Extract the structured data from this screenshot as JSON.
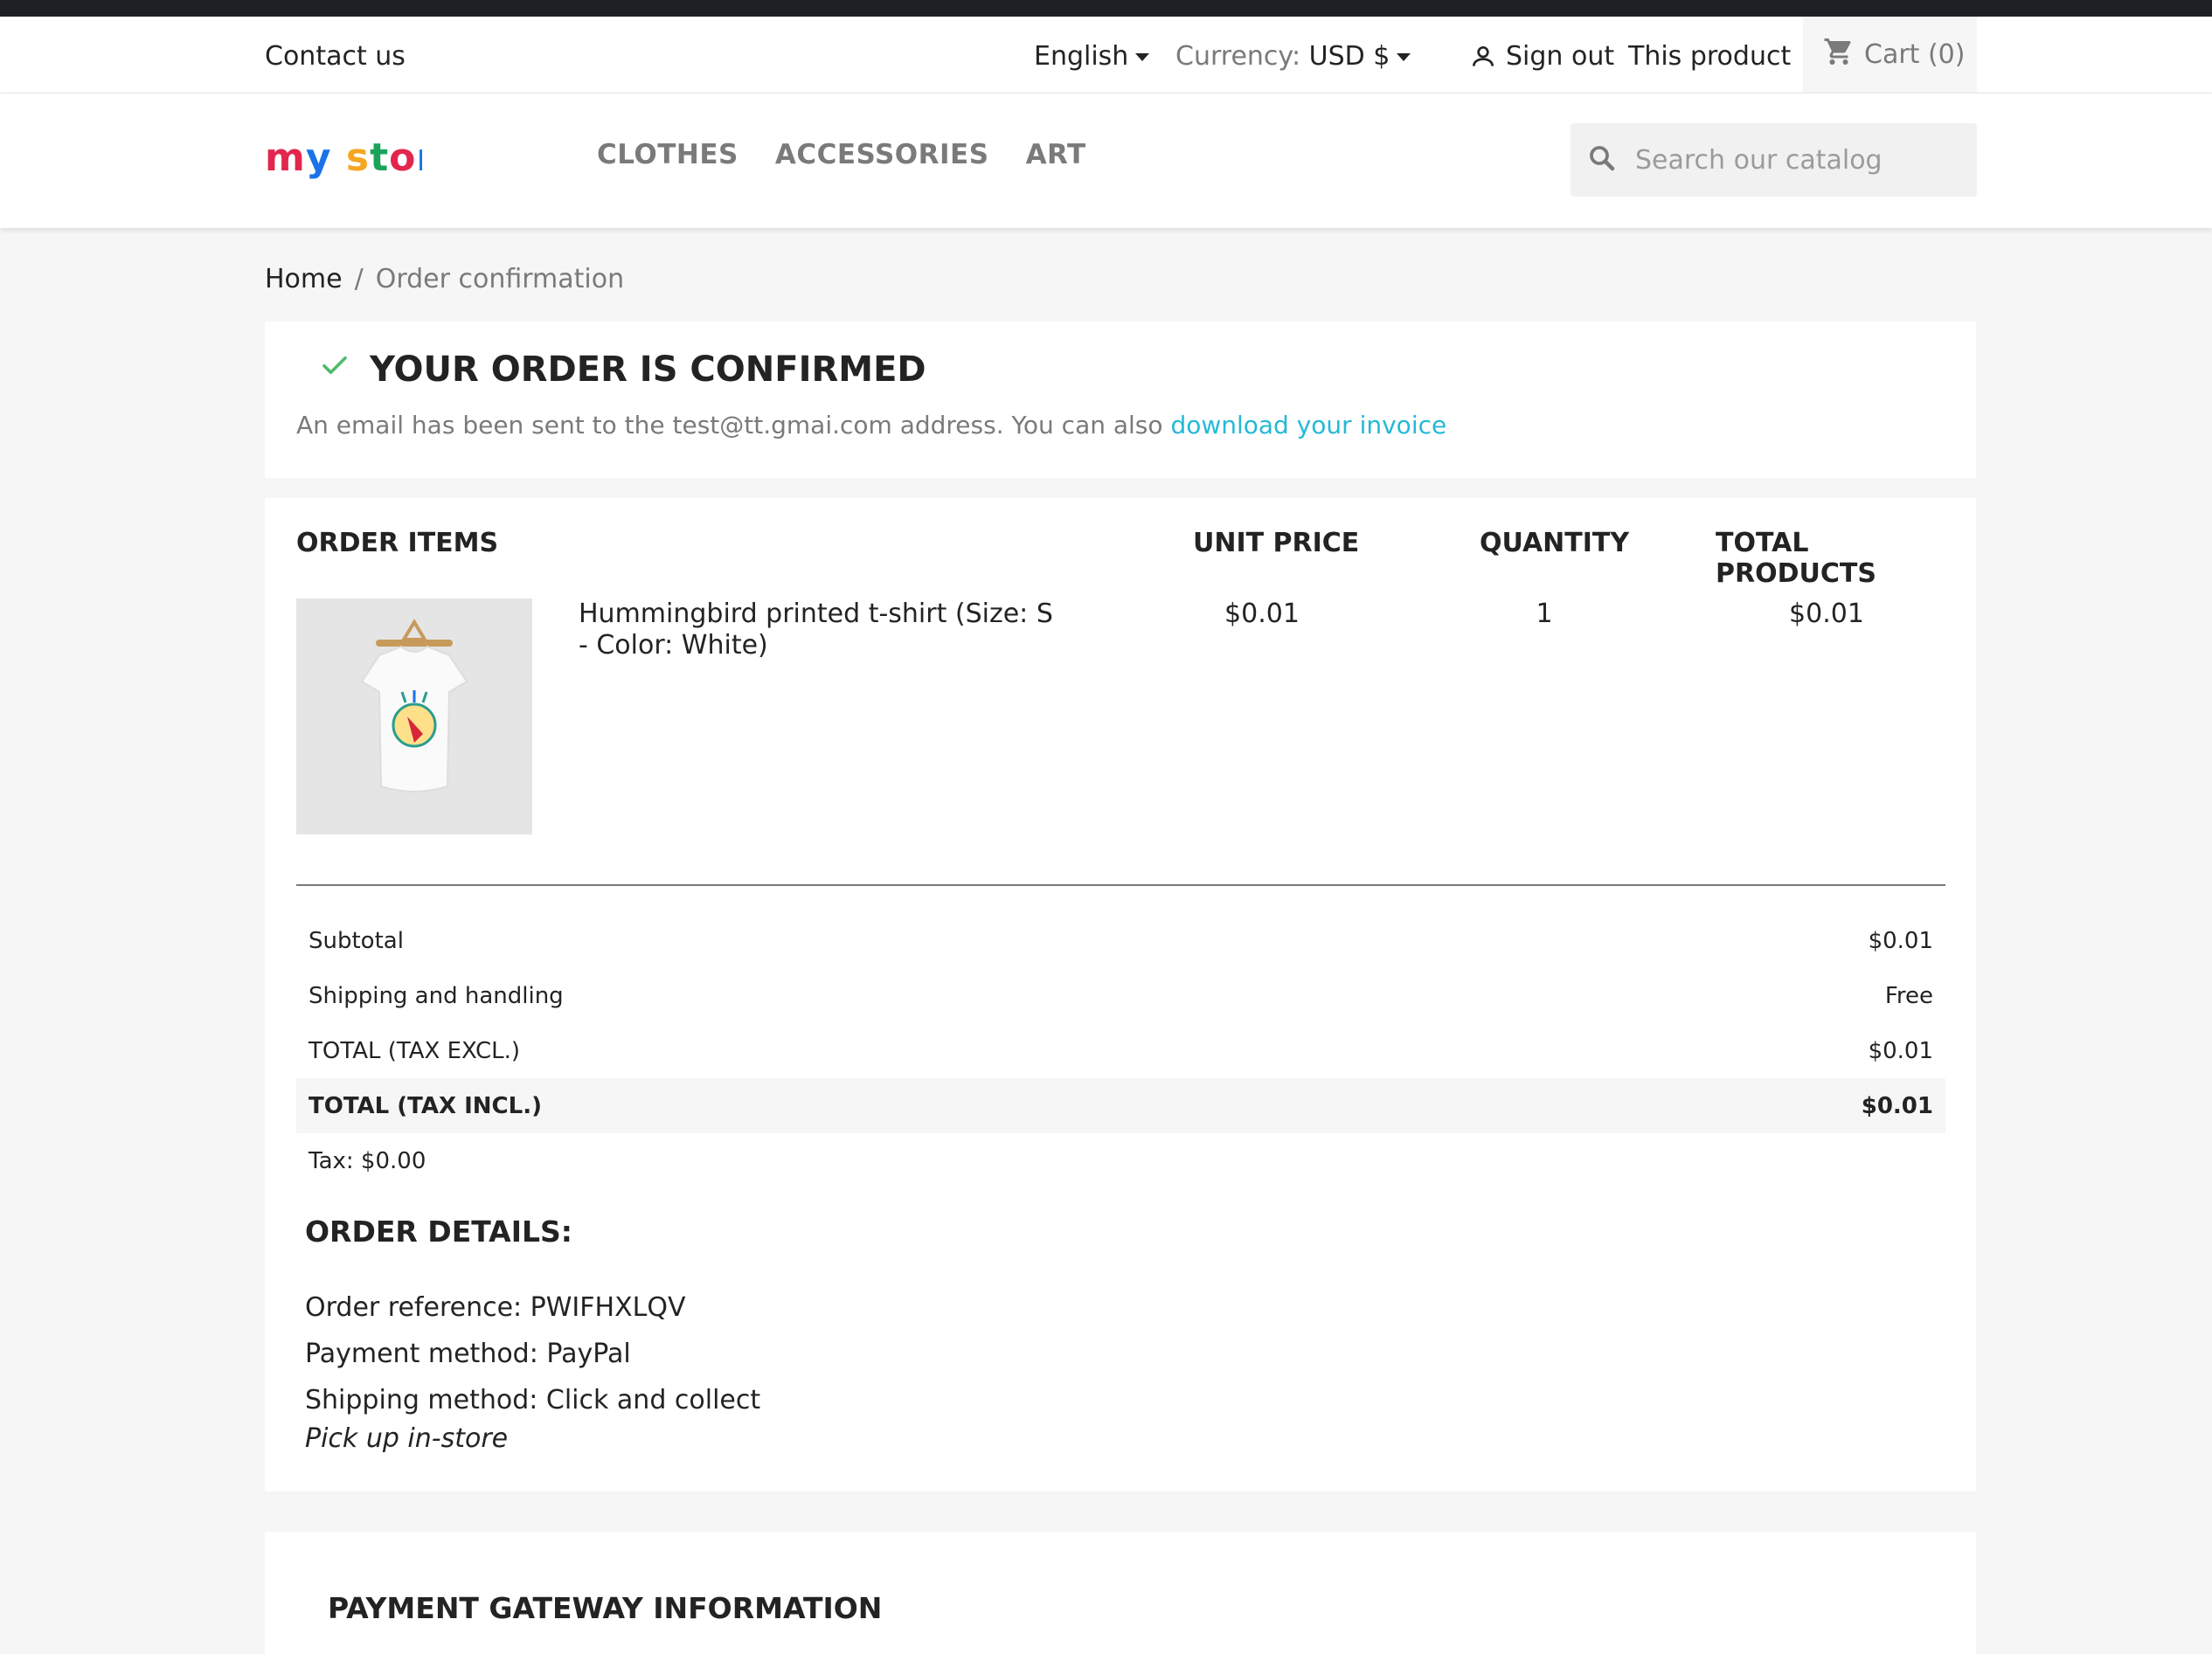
{
  "nav": {
    "contact": "Contact us",
    "language": "English",
    "currency_label": "Currency:",
    "currency_value": "USD $",
    "signout": "Sign out",
    "this_product": "This product",
    "cart": "Cart (0)"
  },
  "header": {
    "logo": "my store",
    "menu": [
      "CLOTHES",
      "ACCESSORIES",
      "ART"
    ],
    "search_placeholder": "Search our catalog"
  },
  "breadcrumb": {
    "home": "Home",
    "separator": "/",
    "current": "Order confirmation"
  },
  "confirmation": {
    "title": "YOUR ORDER IS CONFIRMED",
    "text": "An email has been sent to the test@tt.gmai.com address. You can also",
    "link": "download your invoice"
  },
  "order": {
    "headers": {
      "items": "ORDER ITEMS",
      "unit_price": "UNIT PRICE",
      "quantity": "QUANTITY",
      "total": "TOTAL PRODUCTS"
    },
    "item": {
      "name": "Hummingbird printed t-shirt (Size: S - Color: White)",
      "unit_price": "$0.01",
      "quantity": "1",
      "total": "$0.01"
    },
    "totals": {
      "subtotal_label": "Subtotal",
      "subtotal_value": "$0.01",
      "shipping_label": "Shipping and handling",
      "shipping_value": "Free",
      "excl_label": "TOTAL (TAX EXCL.)",
      "excl_value": "$0.01",
      "incl_label": "TOTAL (TAX INCL.)",
      "incl_value": "$0.01",
      "tax": "Tax: $0.00"
    },
    "details": {
      "title": "ORDER DETAILS:",
      "reference": "Order reference: PWIFHXLQV",
      "payment": "Payment method: PayPal",
      "shipping": "Shipping method: Click and collect",
      "shipping_sub": "Pick up in-store"
    }
  },
  "payment_gateway": {
    "title": "PAYMENT GATEWAY INFORMATION"
  },
  "colors": {
    "accent_link": "#24b9d7",
    "check": "#4cbb6c",
    "page_bg": "#f6f6f6"
  }
}
